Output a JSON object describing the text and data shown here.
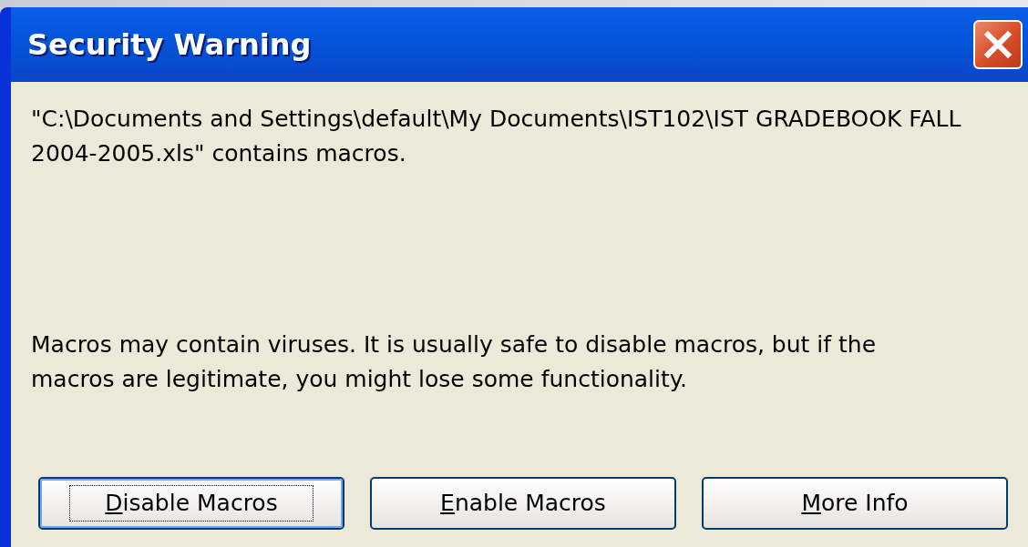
{
  "window": {
    "title": "Security Warning"
  },
  "message": "\"C:\\Documents and Settings\\default\\My Documents\\IST102\\IST GRADEBOOK FALL 2004-2005.xls\" contains macros.",
  "warning": "Macros may contain viruses. It is usually safe to disable macros, but if the macros are legitimate, you might lose some functionality.",
  "buttons": [
    {
      "mnemonic": "D",
      "rest": "isable Macros",
      "focused": true
    },
    {
      "mnemonic": "E",
      "rest": "nable Macros",
      "focused": false
    },
    {
      "mnemonic": "M",
      "rest": "ore Info",
      "focused": false
    }
  ]
}
